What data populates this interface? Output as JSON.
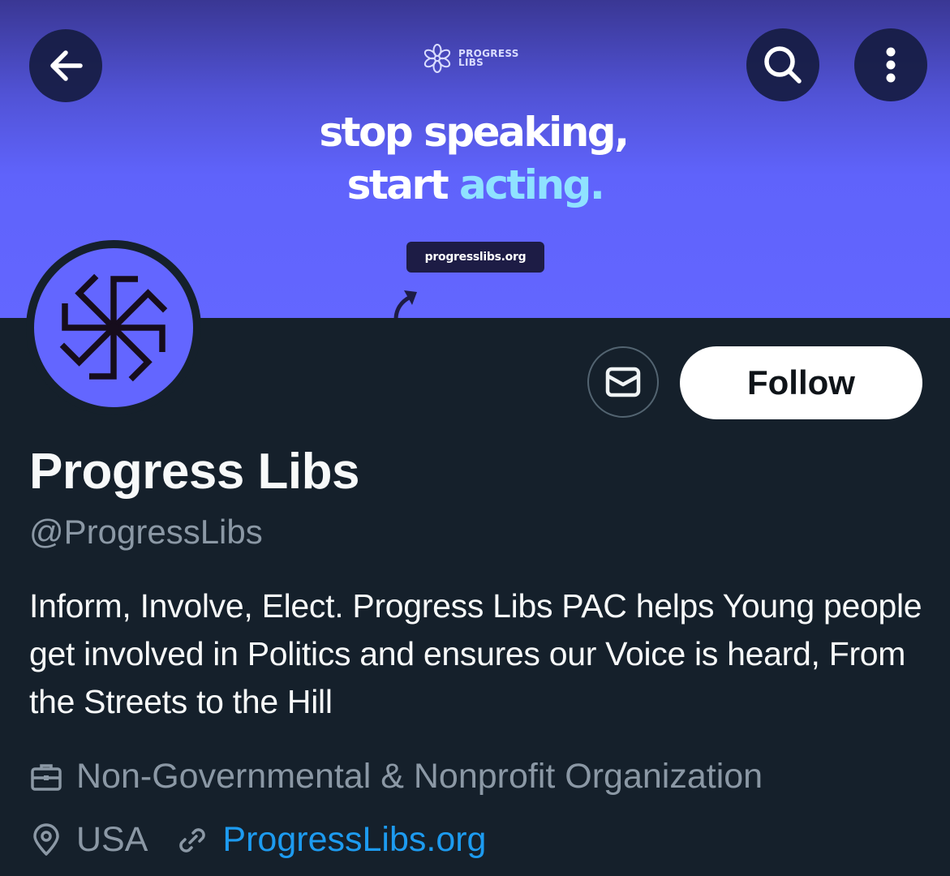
{
  "header": {
    "back_icon": "arrow-left-icon",
    "search_icon": "search-icon",
    "more_icon": "more-vertical-icon"
  },
  "banner": {
    "logo_line1": "PROGRESS",
    "logo_line2": "LIBS",
    "headline_line1": "stop speaking,",
    "headline_line2_start": "start",
    "headline_line2_accent": "acting.",
    "url": "progresslibs.org",
    "background_color": "#6366ff",
    "accent_color": "#8fe2ff"
  },
  "actions": {
    "message_icon": "envelope-icon",
    "follow_label": "Follow"
  },
  "profile": {
    "name": "Progress Libs",
    "handle": "@ProgressLibs",
    "bio": "Inform, Involve, Elect. Progress Libs PAC helps Young people get involved in Politics and ensures our Voice is heard, From the Streets to the Hill",
    "category": "Non-Governmental & Nonprofit Organization",
    "location": "USA",
    "website": "ProgressLibs.org"
  },
  "colors": {
    "background": "#15202b",
    "secondary_text": "#8b98a5",
    "link": "#1d9bf0"
  }
}
